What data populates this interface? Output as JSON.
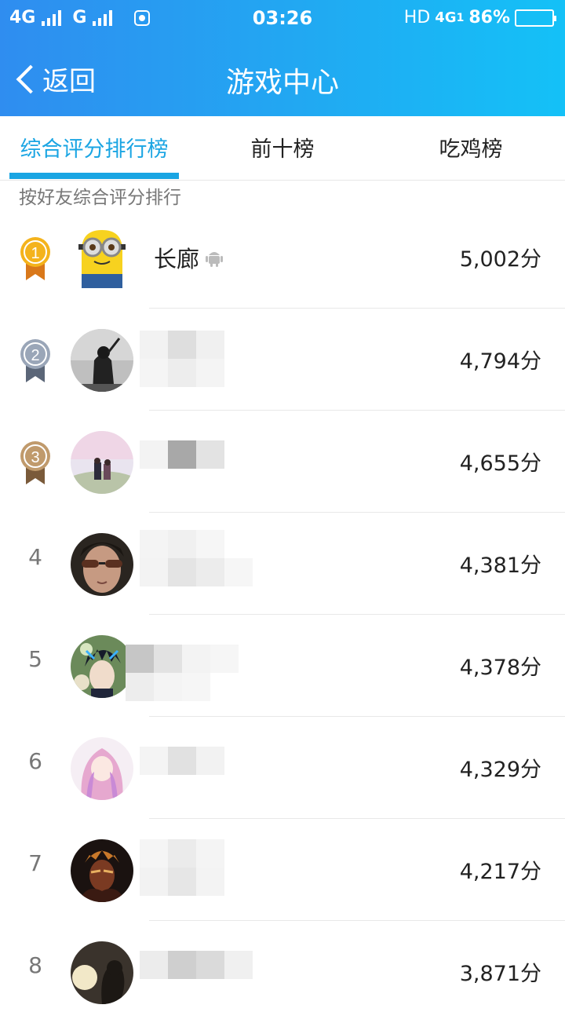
{
  "status_bar": {
    "network_1": "4G",
    "network_2": "G",
    "time": "03:26",
    "hd": "HD",
    "network_3": "4G",
    "sim_label": "1",
    "battery": "86%",
    "battery_level": 0.86
  },
  "nav": {
    "back_label": "返回",
    "title": "游戏中心"
  },
  "tabs": [
    {
      "label": "综合评分排行榜",
      "active": true
    },
    {
      "label": "前十榜",
      "active": false
    },
    {
      "label": "吃鸡榜",
      "active": false
    }
  ],
  "subtitle": "按好友综合评分排行",
  "colors": {
    "accent": "#1aa5e3",
    "header_start": "#2f8df0",
    "header_end": "#14c1f7",
    "gold": "#f0a017",
    "silver": "#8a96a8",
    "bronze": "#b28a5c"
  },
  "rankings": [
    {
      "rank": "1",
      "medal": "gold",
      "name": "长廊",
      "platform_icon": "android-icon",
      "score": "5,002分"
    },
    {
      "rank": "2",
      "medal": "silver",
      "name": "",
      "score": "4,794分"
    },
    {
      "rank": "3",
      "medal": "bronze",
      "name": "",
      "score": "4,655分"
    },
    {
      "rank": "4",
      "name": "",
      "score": "4,381分"
    },
    {
      "rank": "5",
      "name": "",
      "score": "4,378分"
    },
    {
      "rank": "6",
      "name": "",
      "score": "4,329分"
    },
    {
      "rank": "7",
      "name": "",
      "score": "4,217分"
    },
    {
      "rank": "8",
      "name": "",
      "score": "3,871分"
    }
  ]
}
